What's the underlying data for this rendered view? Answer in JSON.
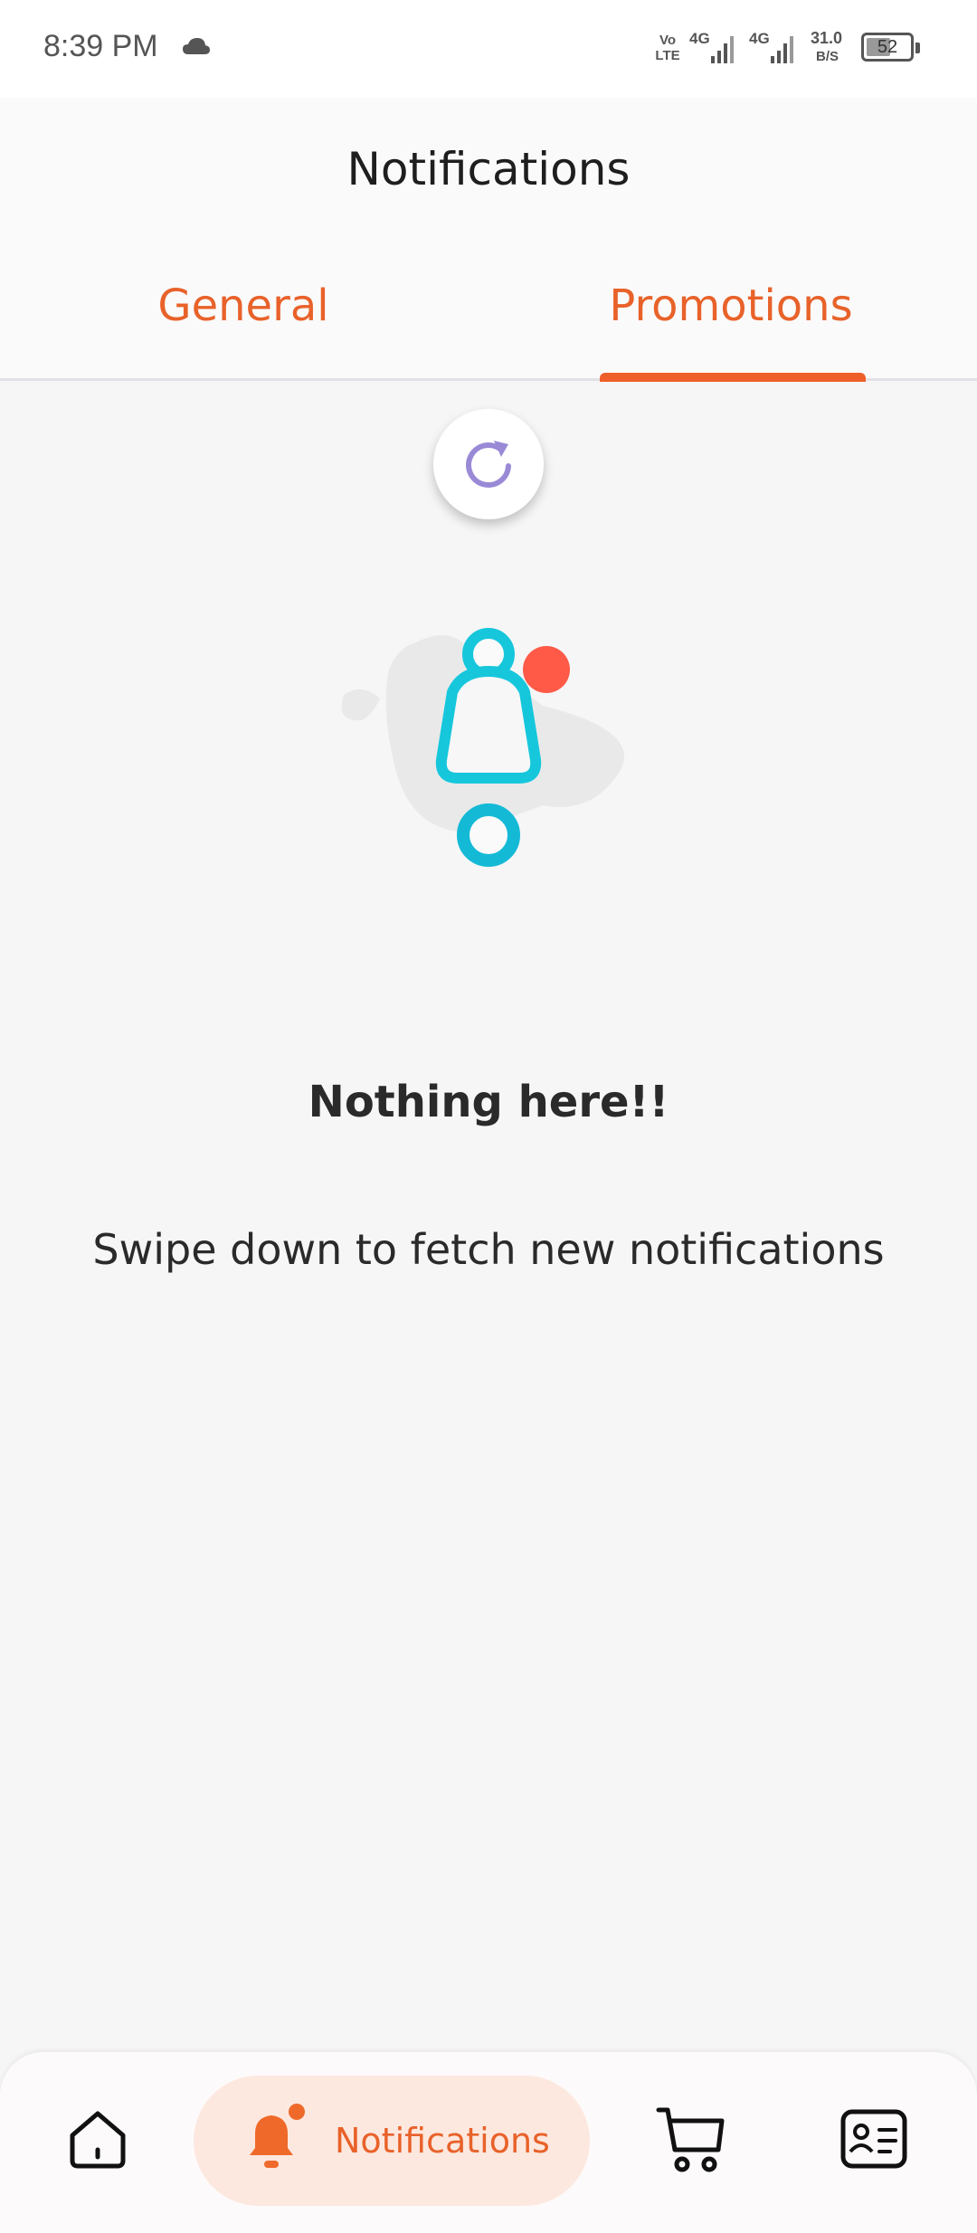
{
  "status_bar": {
    "time": "8:39 PM",
    "volte": "Vo\nLTE",
    "network_1": "4G",
    "network_2": "4G",
    "speed_value": "31.0",
    "speed_unit": "B/S",
    "battery": "52"
  },
  "header": {
    "title": "Notifications"
  },
  "tabs": [
    {
      "label": "General",
      "selected": false
    },
    {
      "label": "Promotions",
      "selected": true
    }
  ],
  "empty_state": {
    "title": "Nothing here!!",
    "subtitle": "Swipe down to fetch new notifications"
  },
  "bottom_nav": {
    "items": [
      {
        "icon": "home-icon"
      },
      {
        "icon": "bell-icon",
        "label": "Notifications",
        "active": true
      },
      {
        "icon": "cart-icon"
      },
      {
        "icon": "profile-card-icon"
      }
    ]
  },
  "colors": {
    "accent": "#e8622a",
    "bell": "#16c7dc",
    "dot": "#ff5a47",
    "active_pill": "#fde8df"
  }
}
